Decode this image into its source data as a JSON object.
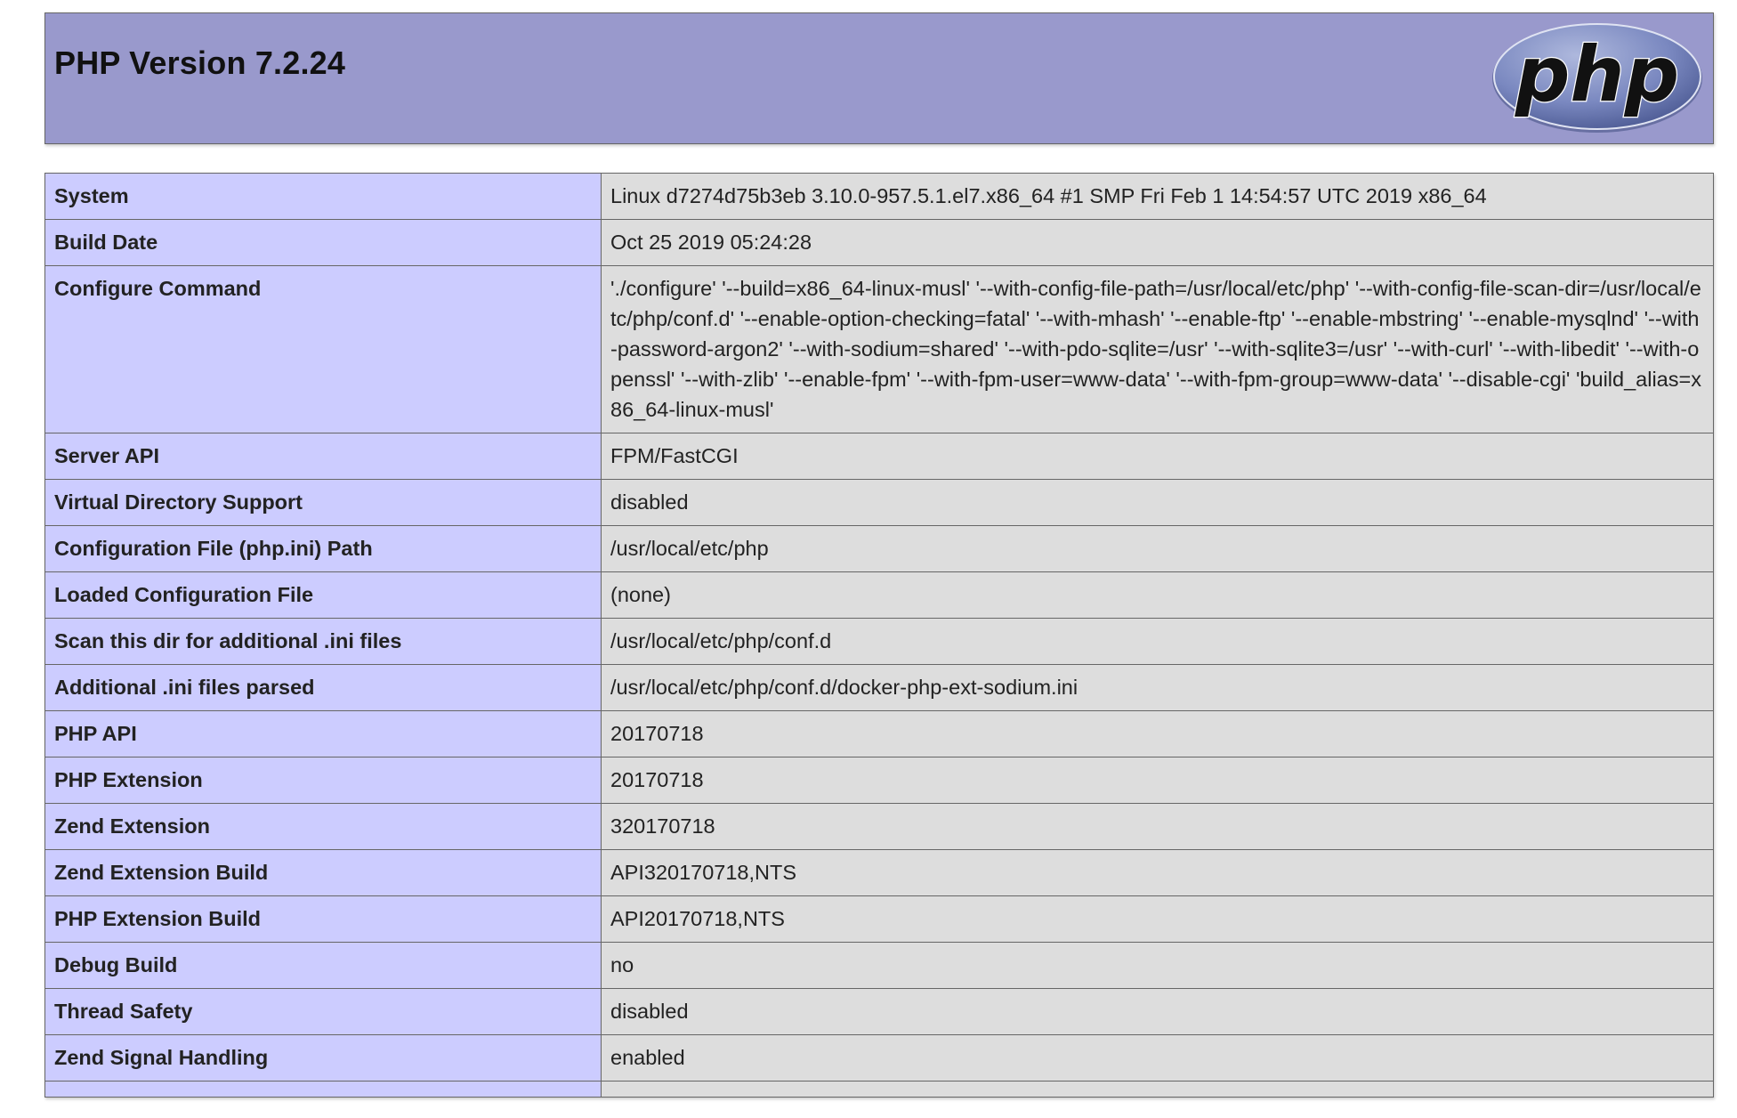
{
  "header": {
    "title": "PHP Version 7.2.24",
    "logo_text": "php",
    "logo_colors": {
      "ellipse": "#6c7eb7",
      "text": "#000000",
      "outline": "#ffffff"
    }
  },
  "colors": {
    "header_bg": "#9999cc",
    "key_cell_bg": "#ccccff",
    "value_cell_bg": "#dddddd",
    "border": "#666666"
  },
  "rows": [
    {
      "key": "System",
      "value": "Linux d7274d75b3eb 3.10.0-957.5.1.el7.x86_64 #1 SMP Fri Feb 1 14:54:57 UTC 2019 x86_64"
    },
    {
      "key": "Build Date",
      "value": "Oct 25 2019 05:24:28"
    },
    {
      "key": "Configure Command",
      "value": "'./configure' '--build=x86_64-linux-musl' '--with-config-file-path=/usr/local/etc/php' '--with-config-file-scan-dir=/usr/local/etc/php/conf.d' '--enable-option-checking=fatal' '--with-mhash' '--enable-ftp' '--enable-mbstring' '--enable-mysqlnd' '--with-password-argon2' '--with-sodium=shared' '--with-pdo-sqlite=/usr' '--with-sqlite3=/usr' '--with-curl' '--with-libedit' '--with-openssl' '--with-zlib' '--enable-fpm' '--with-fpm-user=www-data' '--with-fpm-group=www-data' '--disable-cgi' 'build_alias=x86_64-linux-musl'"
    },
    {
      "key": "Server API",
      "value": "FPM/FastCGI"
    },
    {
      "key": "Virtual Directory Support",
      "value": "disabled"
    },
    {
      "key": "Configuration File (php.ini) Path",
      "value": "/usr/local/etc/php"
    },
    {
      "key": "Loaded Configuration File",
      "value": "(none)"
    },
    {
      "key": "Scan this dir for additional .ini files",
      "value": "/usr/local/etc/php/conf.d"
    },
    {
      "key": "Additional .ini files parsed",
      "value": "/usr/local/etc/php/conf.d/docker-php-ext-sodium.ini"
    },
    {
      "key": "PHP API",
      "value": "20170718"
    },
    {
      "key": "PHP Extension",
      "value": "20170718"
    },
    {
      "key": "Zend Extension",
      "value": "320170718"
    },
    {
      "key": "Zend Extension Build",
      "value": "API320170718,NTS"
    },
    {
      "key": "PHP Extension Build",
      "value": "API20170718,NTS"
    },
    {
      "key": "Debug Build",
      "value": "no"
    },
    {
      "key": "Thread Safety",
      "value": "disabled"
    },
    {
      "key": "Zend Signal Handling",
      "value": "enabled"
    },
    {
      "key": "",
      "value": ""
    }
  ]
}
